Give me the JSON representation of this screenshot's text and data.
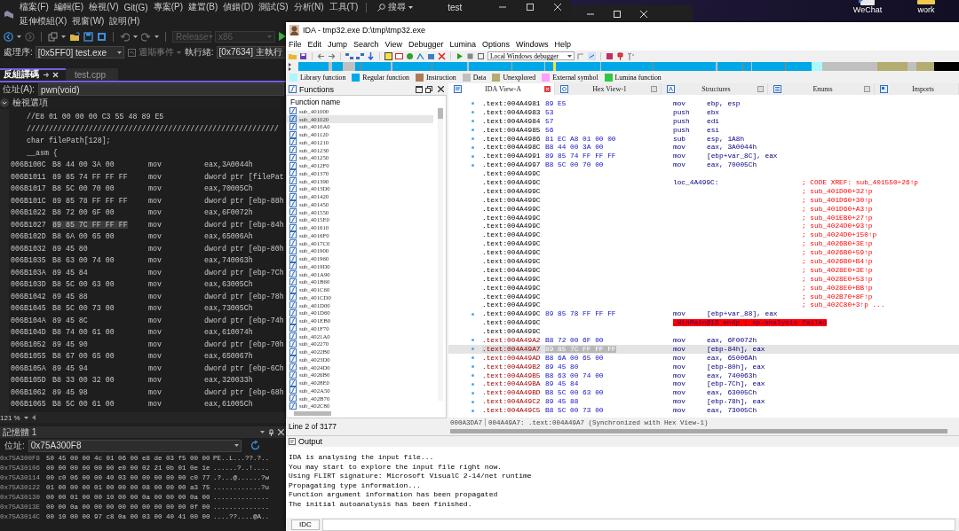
{
  "desktop": {
    "icons": [
      {
        "label": "WeChat"
      },
      {
        "label": "work"
      }
    ]
  },
  "vs": {
    "menu_top": [
      "檔案(F)",
      "編輯(E)",
      "檢視(V)",
      "Git(G)",
      "專案(P)",
      "建置(B)",
      "偵錯(D)",
      "測試(S)",
      "分析(N)",
      "工具(T)"
    ],
    "menu_bottom": [
      "延伸模組(X)",
      "視窗(W)",
      "說明(H)"
    ],
    "search": "搜尋",
    "title": "test",
    "configuration": {
      "value": "Release",
      "disabled": true
    },
    "platform": {
      "value": "x86",
      "disabled": true
    },
    "process_label": "處理序:",
    "process": "[0x5FF0] test.exe",
    "lifecycle_events": "週期事件",
    "thread_label": "執行緒:",
    "thread": "[0x7634] 主執行",
    "tabs": [
      {
        "label": "反組譯碼",
        "selected": true
      },
      {
        "label": "test.cpp",
        "selected": false
      }
    ],
    "address_label": "位址(A):",
    "address": "pwn(void)",
    "view_options": "檢視選項",
    "source_lines": [
      "//E8 01 00 00 00 C3 55 48 89 E5",
      "/////////////////////////////////////////////////////////",
      "char filePath[128];",
      "__asm {"
    ],
    "asm_rows": [
      {
        "address": "006B100C",
        "bytes": "B8 44 00 3A 00",
        "mnemonic": "mov",
        "operand": "eax,3A0044h",
        "selected": false
      },
      {
        "address": "006B1011",
        "bytes": "89 85 74 FF FF FF",
        "mnemonic": "mov",
        "operand": "dword ptr [filePat",
        "selected": false
      },
      {
        "address": "006B1017",
        "bytes": "B8 5C 00 70 00",
        "mnemonic": "mov",
        "operand": "eax,70005Ch",
        "selected": false
      },
      {
        "address": "006B101C",
        "bytes": "89 85 78 FF FF FF",
        "mnemonic": "mov",
        "operand": "dword ptr [ebp-88h",
        "selected": false
      },
      {
        "address": "006B1022",
        "bytes": "B8 72 00 6F 00",
        "mnemonic": "mov",
        "operand": "eax,6F0072h",
        "selected": false
      },
      {
        "address": "006B1027",
        "bytes": "89 85 7C FF FF FF",
        "mnemonic": "mov",
        "operand": "dword ptr [ebp-84h",
        "selected": true
      },
      {
        "address": "006B102D",
        "bytes": "B8 6A 00 65 00",
        "mnemonic": "mov",
        "operand": "eax,65006Ah",
        "selected": false
      },
      {
        "address": "006B1032",
        "bytes": "89 45 80",
        "mnemonic": "mov",
        "operand": "dword ptr [ebp-80h",
        "selected": false
      },
      {
        "address": "006B1035",
        "bytes": "B8 63 00 74 00",
        "mnemonic": "mov",
        "operand": "eax,740063h",
        "selected": false
      },
      {
        "address": "006B103A",
        "bytes": "89 45 84",
        "mnemonic": "mov",
        "operand": "dword ptr [ebp-7Ch",
        "selected": false
      },
      {
        "address": "006B103D",
        "bytes": "B8 5C 00 63 00",
        "mnemonic": "mov",
        "operand": "eax,63005Ch",
        "selected": false
      },
      {
        "address": "006B1042",
        "bytes": "89 45 88",
        "mnemonic": "mov",
        "operand": "dword ptr [ebp-78h",
        "selected": false
      },
      {
        "address": "006B1045",
        "bytes": "B8 5C 00 73 00",
        "mnemonic": "mov",
        "operand": "eax,73005Ch",
        "selected": false
      },
      {
        "address": "006B104A",
        "bytes": "89 45 8C",
        "mnemonic": "mov",
        "operand": "dword ptr [ebp-74h",
        "selected": false
      },
      {
        "address": "006B104D",
        "bytes": "B8 74 00 61 00",
        "mnemonic": "mov",
        "operand": "eax,610074h",
        "selected": false
      },
      {
        "address": "006B1052",
        "bytes": "89 45 90",
        "mnemonic": "mov",
        "operand": "dword ptr [ebp-70h",
        "selected": false
      },
      {
        "address": "006B1055",
        "bytes": "B8 67 00 65 00",
        "mnemonic": "mov",
        "operand": "eax,650067h",
        "selected": false
      },
      {
        "address": "006B105A",
        "bytes": "89 45 94",
        "mnemonic": "mov",
        "operand": "dword ptr [ebp-6Ch",
        "selected": false
      },
      {
        "address": "006B105D",
        "bytes": "B8 33 00 32 00",
        "mnemonic": "mov",
        "operand": "eax,320033h",
        "selected": false
      },
      {
        "address": "006B1062",
        "bytes": "89 45 98",
        "mnemonic": "mov",
        "operand": "dword ptr [ebp-68h",
        "selected": false
      },
      {
        "address": "006B1065",
        "bytes": "B8 5C 00 61 00",
        "mnemonic": "mov",
        "operand": "eax,61005Ch",
        "selected": false
      }
    ],
    "zoom": "121 %",
    "memory": {
      "title": "記憶體 1",
      "address_label": "位址:",
      "address": "0x75A300F8",
      "rows": [
        {
          "address": "0x75A300F8",
          "bytes": "50 45 00 00 4c 01 06 00 e8 de 03 f5 00 00",
          "ascii": "PE..L...??.?.."
        },
        {
          "address": "0x75A30106",
          "bytes": "00 00 00 00 00 00 e0 00 02 21 0b 01 0e 1e",
          "ascii": "......?..!...."
        },
        {
          "address": "0x75A30114",
          "bytes": "00 c0 06 00 00 40 03 00 00 00 00 00 c0 77",
          "ascii": ".?...@......?w"
        },
        {
          "address": "0x75A30122",
          "bytes": "01 00 00 00 01 00 00 00 08 00 00 00 a3 75",
          "ascii": "............?u"
        },
        {
          "address": "0x75A30130",
          "bytes": "00 00 01 00 00 10 00 00 0a 00 00 00 0a 00",
          "ascii": ".............."
        },
        {
          "address": "0x75A3013E",
          "bytes": "00 00 0a 00 00 00 00 00 00 00 00 00 0f 00",
          "ascii": ".............."
        },
        {
          "address": "0x75A3014C",
          "bytes": "00 10 00 00 97 c8 0a 00 03 00 40 41 00 00",
          "ascii": "....??....@A.."
        }
      ]
    }
  },
  "ida": {
    "title": "IDA - tmp32.exe D:\\tmp\\tmp32.exe",
    "menu": [
      "File",
      "Edit",
      "Jump",
      "Search",
      "View",
      "Debugger",
      "Lumina",
      "Options",
      "Windows",
      "Help"
    ],
    "debugger": "Local Windows debugger",
    "legend": [
      {
        "label": "Library function",
        "color": "#aef6fe"
      },
      {
        "label": "Regular function",
        "color": "#00a8e8"
      },
      {
        "label": "Instruction",
        "color": "#b07a58"
      },
      {
        "label": "Data",
        "color": "#c0c0c0"
      },
      {
        "label": "Unexplored",
        "color": "#b4ac70"
      },
      {
        "label": "External symbol",
        "color": "#fca0fc"
      },
      {
        "label": "Lumina function",
        "color": "#30c840"
      }
    ],
    "functions": {
      "title": "Functions",
      "column": "Function name",
      "footer": "Line 2 of 3177",
      "items": [
        {
          "name": "sub_401000",
          "selected": false
        },
        {
          "name": "sub_401020",
          "selected": true
        },
        {
          "name": "sub_4010A0",
          "selected": false
        },
        {
          "name": "sub_401120",
          "selected": false
        },
        {
          "name": "sub_401210",
          "selected": false
        },
        {
          "name": "sub_401230",
          "selected": false
        },
        {
          "name": "sub_401250",
          "selected": false
        },
        {
          "name": "sub_4012F0",
          "selected": false
        },
        {
          "name": "sub_401370",
          "selected": false
        },
        {
          "name": "sub_401390",
          "selected": false
        },
        {
          "name": "sub_4013D0",
          "selected": false
        },
        {
          "name": "sub_401420",
          "selected": false
        },
        {
          "name": "sub_401450",
          "selected": false
        },
        {
          "name": "sub_401550",
          "selected": false
        },
        {
          "name": "sub_4015E0",
          "selected": false
        },
        {
          "name": "sub_401610",
          "selected": false
        },
        {
          "name": "sub_4016F0",
          "selected": false
        },
        {
          "name": "sub_4017C0",
          "selected": false
        },
        {
          "name": "sub_401900",
          "selected": false
        },
        {
          "name": "sub_401960",
          "selected": false
        },
        {
          "name": "sub_4019D0",
          "selected": false
        },
        {
          "name": "sub_401A90",
          "selected": false
        },
        {
          "name": "sub_401B60",
          "selected": false
        },
        {
          "name": "sub_401C60",
          "selected": false
        },
        {
          "name": "sub_401CD0",
          "selected": false
        },
        {
          "name": "sub_401D00",
          "selected": false
        },
        {
          "name": "sub_401D60",
          "selected": false
        },
        {
          "name": "sub_401EB0",
          "selected": false
        },
        {
          "name": "sub_401F70",
          "selected": false
        },
        {
          "name": "sub_4021A0",
          "selected": false
        },
        {
          "name": "sub_402270",
          "selected": false
        },
        {
          "name": "sub_4022B0",
          "selected": false
        },
        {
          "name": "sub_4023D0",
          "selected": false
        },
        {
          "name": "sub_4024D0",
          "selected": false
        },
        {
          "name": "sub_4026B0",
          "selected": false
        },
        {
          "name": "sub_4028E0",
          "selected": false
        },
        {
          "name": "sub_402A50",
          "selected": false
        },
        {
          "name": "sub_402B70",
          "selected": false
        },
        {
          "name": "sub_402C80",
          "selected": false
        }
      ]
    },
    "tabs": [
      {
        "label": "IDA View-A",
        "selected": true
      },
      {
        "label": "Hex View-1",
        "selected": false
      },
      {
        "label": "Structures",
        "selected": false
      },
      {
        "label": "Enums",
        "selected": false
      },
      {
        "label": "Imports",
        "selected": false
      }
    ],
    "disasm": [
      {
        "address": ".text:004A4981",
        "bytes": "89 E5",
        "mnemonic": "mov",
        "operands": "ebp, esp",
        "in_function": true,
        "selected": false
      },
      {
        "address": ".text:004A4983",
        "bytes": "53",
        "mnemonic": "push",
        "operands": "ebx",
        "in_function": true,
        "selected": false
      },
      {
        "address": ".text:004A4984",
        "bytes": "57",
        "mnemonic": "push",
        "operands": "edi",
        "in_function": true,
        "selected": false
      },
      {
        "address": ".text:004A4985",
        "bytes": "56",
        "mnemonic": "push",
        "operands": "esi",
        "in_function": true,
        "selected": false
      },
      {
        "address": ".text:004A4986",
        "bytes": "81 EC A8 01 00 00",
        "mnemonic": "sub",
        "operands": "esp, 1A8h",
        "in_function": true,
        "selected": false
      },
      {
        "address": ".text:004A498C",
        "bytes": "B8 44 00 3A 00",
        "mnemonic": "mov",
        "operands": "eax, 3A0044h",
        "in_function": true,
        "selected": false
      },
      {
        "address": ".text:004A4991",
        "bytes": "89 85 74 FF FF FF",
        "mnemonic": "mov",
        "operands": "[ebp+var_8C], eax",
        "in_function": true,
        "selected": false
      },
      {
        "address": ".text:004A4997",
        "bytes": "B8 5C 00 70 00",
        "mnemonic": "mov",
        "operands": "eax, 70005Ch",
        "in_function": true,
        "selected": false
      },
      {
        "address": ".text:004A499C",
        "in_function": true,
        "selected": false
      },
      {
        "address": ".text:004A499C",
        "label": "loc_4A499C:",
        "comment": "; CODE XREF: sub_401550+26↑p",
        "in_function": true,
        "selected": false
      },
      {
        "address": ".text:004A499C",
        "comment": "; sub_401D00+32↑p",
        "in_function": true,
        "selected": false
      },
      {
        "address": ".text:004A499C",
        "comment": "; sub_401D60+30↑p",
        "in_function": true,
        "selected": false
      },
      {
        "address": ".text:004A499C",
        "comment": "; sub_401D60+A3↑p",
        "in_function": true,
        "selected": false
      },
      {
        "address": ".text:004A499C",
        "comment": "; sub_401EB0+27↑p",
        "in_function": true,
        "selected": false
      },
      {
        "address": ".text:004A499C",
        "comment": "; sub_4024D0+93↑p",
        "in_function": true,
        "selected": false
      },
      {
        "address": ".text:004A499C",
        "comment": "; sub_4024D0+150↑p",
        "in_function": true,
        "selected": false
      },
      {
        "address": ".text:004A499C",
        "comment": "; sub_4026B0+3E↑p",
        "in_function": true,
        "selected": false
      },
      {
        "address": ".text:004A499C",
        "comment": "; sub_4026B0+59↑p",
        "in_function": true,
        "selected": false
      },
      {
        "address": ".text:004A499C",
        "comment": "; sub_4026B0+B4↑p",
        "in_function": true,
        "selected": false
      },
      {
        "address": ".text:004A499C",
        "comment": "; sub_4028E0+3E↑p",
        "in_function": true,
        "selected": false
      },
      {
        "address": ".text:004A499C",
        "comment": "; sub_4028E0+53↑p",
        "in_function": true,
        "selected": false
      },
      {
        "address": ".text:004A499C",
        "comment": "; sub_4028E0+BB↑p",
        "in_function": true,
        "selected": false
      },
      {
        "address": ".text:004A499C",
        "comment": "; sub_402B70+8F↑p",
        "in_function": true,
        "selected": false
      },
      {
        "address": ".text:004A499C",
        "comment": "; sub_402C80+3↑p ...",
        "in_function": true,
        "selected": false
      },
      {
        "address": ".text:004A499C",
        "bytes": "89 85 78 FF FF FF",
        "mnemonic": "mov",
        "operands": "[ebp+var_88], eax",
        "in_function": true,
        "selected": false
      },
      {
        "address": ".text:004A499C",
        "error": "_WinMain@16 endp ; sp-analysis failed",
        "in_function": true,
        "selected": false
      },
      {
        "address": ".text:004A499C",
        "in_function": true,
        "selected": false
      },
      {
        "address": ".text:004A49A2",
        "bytes": "B8 72 00 6F 00",
        "mnemonic": "mov",
        "operands": "eax, 6F0072h",
        "in_function": false,
        "selected": false
      },
      {
        "address": ".text:004A49A7",
        "bytes": "89 85 7C FF FF FF",
        "mnemonic": "mov",
        "operands": "[ebp-84h], eax",
        "in_function": false,
        "selected": true
      },
      {
        "address": ".text:004A49AD",
        "bytes": "B8 6A 00 65 00",
        "mnemonic": "mov",
        "operands": "eax, 65006Ah",
        "in_function": false,
        "selected": false
      },
      {
        "address": ".text:004A49B2",
        "bytes": "89 45 80",
        "mnemonic": "mov",
        "operands": "[ebp-80h], eax",
        "in_function": false,
        "selected": false
      },
      {
        "address": ".text:004A49B5",
        "bytes": "B8 63 00 74 00",
        "mnemonic": "mov",
        "operands": "eax, 740063h",
        "in_function": false,
        "selected": false
      },
      {
        "address": ".text:004A49BA",
        "bytes": "89 45 84",
        "mnemonic": "mov",
        "operands": "[ebp-7Ch], eax",
        "in_function": false,
        "selected": false
      },
      {
        "address": ".text:004A49BD",
        "bytes": "B8 5C 00 63 00",
        "mnemonic": "mov",
        "operands": "eax, 63005Ch",
        "in_function": false,
        "selected": false
      },
      {
        "address": ".text:004A49C2",
        "bytes": "89 45 88",
        "mnemonic": "mov",
        "operands": "[ebp-78h], eax",
        "in_function": false,
        "selected": false
      },
      {
        "address": ".text:004A49C5",
        "bytes": "B8 5C 00 73 00",
        "mnemonic": "mov",
        "operands": "eax, 73005Ch",
        "in_function": false,
        "selected": false
      }
    ],
    "status_offset": "000A3DA7",
    "status_text": "004A49A7: .text:004A49A7 (Synchronized with Hex View-1)",
    "output": {
      "title": "Output",
      "lines": [
        "IDA is analysing the input file...",
        "You may start to explore the input file right now.",
        "Using FLIRT signature: Microsoft VisualC 2-14/net runtime",
        "Propagating type information...",
        "Function argument information has been propagated",
        "The initial autoanalysis has been finished."
      ],
      "command_button": "IDC"
    }
  }
}
